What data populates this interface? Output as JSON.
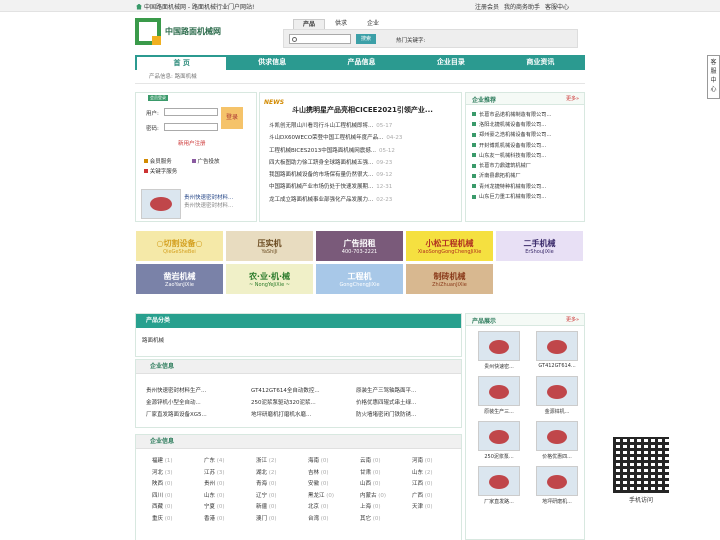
{
  "topbar": {
    "site_text": "中国路面机械网 - 路面机械行业门户网站!",
    "links": [
      "注册会员",
      "我的商务助手",
      "客服中心"
    ]
  },
  "logo": {
    "text": "中国路面机械网"
  },
  "search": {
    "tabs": [
      "产品",
      "供求",
      "企业"
    ],
    "placeholder": "",
    "button": "搜索",
    "hot_label": "热门关键字:"
  },
  "nav": [
    "首 页",
    "供求信息",
    "产品信息",
    "企业目录",
    "商业资讯"
  ],
  "breadcrumb": "产品信息: 路面机械",
  "login": {
    "badge": "会员登录",
    "user_label": "用户:",
    "pass_label": "密码:",
    "button": "登录",
    "register": "新用户注册",
    "services": [
      [
        "会员服务",
        "广告投放"
      ],
      [
        "关键字服务"
      ]
    ],
    "product_title": "贵州快速密封材料...",
    "product_sub": "贵州快速密封材料..."
  },
  "news": {
    "tag": "NEWS",
    "headline": "斗山携明星产品亮相CICEE2021引领产业...",
    "items": [
      {
        "t": "斗凯创无限山川看司行斗山工程机械即将...",
        "d": "05-17"
      },
      {
        "t": "斗山DX60WECO荣登中国工程机械年度产品...",
        "d": "04-23"
      },
      {
        "t": "工程机械BICES2013中国路面机械网震撼...",
        "d": "05-12"
      },
      {
        "t": "四大板图助力徐工跻身全球路面机械五强...",
        "d": "09-23"
      },
      {
        "t": "我国路面机械设备的市场保有量仍然很大...",
        "d": "09-12"
      },
      {
        "t": "中国路面机械产业市场仍处于快速发展期...",
        "d": "12-31"
      },
      {
        "t": "龙工成立路面机械事业部强化产品发展力...",
        "d": "02-23"
      }
    ]
  },
  "recommend": {
    "title": "企业推荐",
    "more": "更多»",
    "items": [
      "长葛市品诺机械制造有限公司...",
      "洛阳北捷机械设备有限公司...",
      "郑州豪之浩机械设备有限公司...",
      "开封博凯机械设备有限公司...",
      "山东友一机械科技有限公司...",
      "长葛市力鼎建筑机械厂",
      "沂南县鼎拓机械厂",
      "青州龙捷特种机械有限公司...",
      "山东巨力重工机械有限公司..."
    ]
  },
  "ads": [
    {
      "a": "○切割设备○",
      "b": "QieGeSheBei",
      "c": "#f5e9a8",
      "f": "#d4a020"
    },
    {
      "a": "压实机",
      "b": "YaShiJi",
      "c": "#e8dcc0",
      "f": "#6a4a20"
    },
    {
      "a": "广告招租",
      "b": "400-703-2221",
      "c": "#7a5a7a",
      "f": "#fff"
    },
    {
      "a": "小松工程机械",
      "b": "XiaoSongGongChengJiXie",
      "c": "#f5e040",
      "f": "#b03020"
    },
    {
      "a": "二手机械",
      "b": "ErShouJiXie",
      "c": "#e8e0f5",
      "f": "#3a2a6a"
    },
    {
      "a": "凿岩机械",
      "b": "ZaoYanJiXie",
      "c": "#7a82a8",
      "f": "#fff"
    },
    {
      "a": "农·业·机·械",
      "b": "~ NongYeJiXie ~",
      "c": "#f0f0c8",
      "f": "#2a7a2a"
    },
    {
      "a": "工程机",
      "b": "GongChengJiXie",
      "c": "#a8c8e8",
      "f": "#fff"
    },
    {
      "a": "制砖机械",
      "b": "ZhiZhuanJiXie",
      "c": "#d8b890",
      "f": "#8a3a1a"
    }
  ],
  "category": {
    "title": "产品分类",
    "item": "路面机械"
  },
  "company_info": {
    "title": "企业信息",
    "items": [
      "贵州快速密封材料生产...",
      "GT412GT614全自动数控...",
      "原装生产三驾轴路面平...",
      "金源锌机小型全自动...",
      "250泥浆泵驱动320泥浆...",
      "价格优惠四辊式串土绿...",
      "厂家直发路面设备XG5...",
      "地坪研磨机打磨机水磨...",
      "防火墙堵密闭门铁防锈..."
    ]
  },
  "company_region": {
    "title": "企业信息",
    "provinces": [
      [
        "福建",
        "1"
      ],
      [
        "广东",
        "4"
      ],
      [
        "浙江",
        "2"
      ],
      [
        "海南",
        "0"
      ],
      [
        "云南",
        "0"
      ],
      [
        "河南",
        "0"
      ],
      [
        "河北",
        "3"
      ],
      [
        "江苏",
        "3"
      ],
      [
        "湖北",
        "2"
      ],
      [
        "吉林",
        "0"
      ],
      [
        "甘肃",
        "0"
      ],
      [
        "山东",
        "2"
      ],
      [
        "陕西",
        "0"
      ],
      [
        "贵州",
        "0"
      ],
      [
        "青海",
        "0"
      ],
      [
        "安徽",
        "0"
      ],
      [
        "山西",
        "0"
      ],
      [
        "江西",
        "0"
      ],
      [
        "四川",
        "0"
      ],
      [
        "山东",
        "0"
      ],
      [
        "辽宁",
        "0"
      ],
      [
        "黑龙江",
        "0"
      ],
      [
        "内蒙古",
        "0"
      ],
      [
        "广西",
        "0"
      ],
      [
        "西藏",
        "0"
      ],
      [
        "宁夏",
        "0"
      ],
      [
        "新疆",
        "0"
      ],
      [
        "北京",
        "0"
      ],
      [
        "上海",
        "0"
      ],
      [
        "天津",
        "0"
      ],
      [
        "重庆",
        "0"
      ],
      [
        "香港",
        "0"
      ],
      [
        "澳门",
        "0"
      ],
      [
        "台湾",
        "0"
      ],
      [
        "其它",
        "0"
      ]
    ]
  },
  "product_show": {
    "title": "产品展示",
    "more": "更多»",
    "items": [
      "贵州快速密...",
      "GT412GT614...",
      "原装生产三...",
      "金源锌机...",
      "250泥浆泵...",
      "价格优惠四...",
      "厂家直发路...",
      "地坪研磨机..."
    ]
  },
  "float": {
    "service": "客服中心",
    "qr": "手机访问"
  }
}
